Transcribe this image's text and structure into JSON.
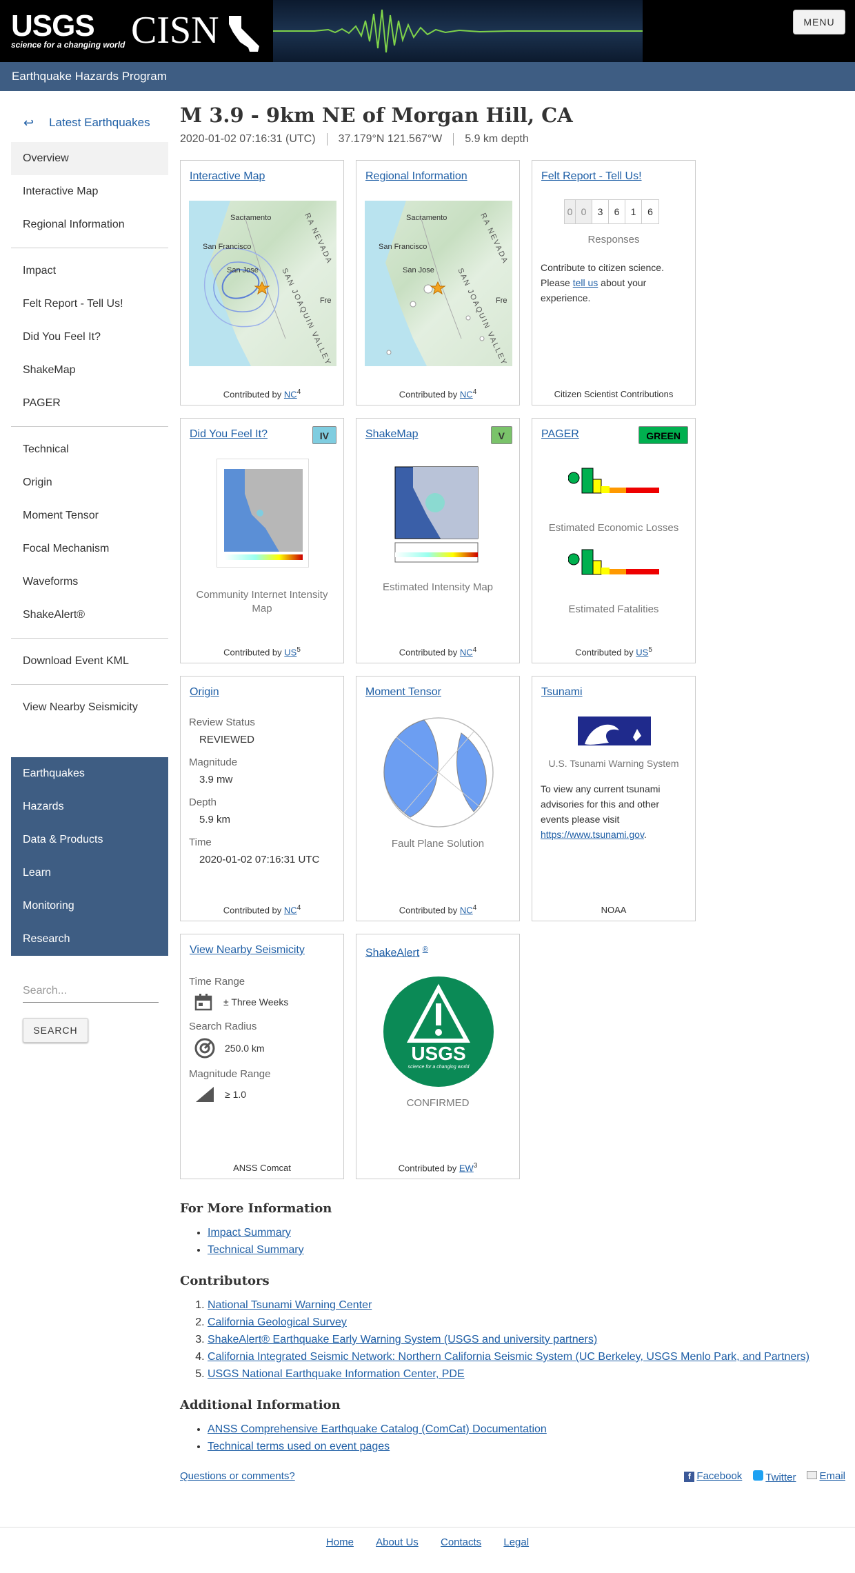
{
  "banner": {
    "usgs_word": "USGS",
    "usgs_tag": "science for a changing world",
    "cisn": "CISN",
    "menu": "MENU"
  },
  "program_title": "Earthquake Hazards Program",
  "sidebar": {
    "back": "Latest Earthquakes",
    "group1": [
      "Overview",
      "Interactive Map",
      "Regional Information"
    ],
    "group2": [
      "Impact",
      "Felt Report - Tell Us!",
      "Did You Feel It?",
      "ShakeMap",
      "PAGER"
    ],
    "group3": [
      "Technical",
      "Origin",
      "Moment Tensor",
      "Focal Mechanism",
      "Waveforms",
      "ShakeAlert®"
    ],
    "group4": [
      "Download Event KML"
    ],
    "group5": [
      "View Nearby Seismicity"
    ],
    "dark": [
      "Earthquakes",
      "Hazards",
      "Data & Products",
      "Learn",
      "Monitoring",
      "Research"
    ],
    "search_placeholder": "Search...",
    "search_button": "SEARCH"
  },
  "event": {
    "title": "M 3.9 - 9km NE of Morgan Hill, CA",
    "time": "2020-01-02 07:16:31 (UTC)",
    "location": "37.179°N 121.567°W",
    "depth": "5.9 km depth"
  },
  "cards": {
    "interactive_map": {
      "title": "Interactive Map",
      "contrib": "Contributed by ",
      "net": "NC",
      "n": "4",
      "map_labels": [
        "Sacramento",
        "San Francisco",
        "San Jose",
        "SAN JOAQUIN VALLEY",
        "RA NEVADA",
        "Fre"
      ]
    },
    "regional": {
      "title": "Regional Information",
      "contrib": "Contributed by ",
      "net": "NC",
      "n": "4",
      "map_labels": [
        "Sacramento",
        "San Francisco",
        "San Jose",
        "SAN JOAQUIN VALLEY",
        "RA NEVADA",
        "Fre"
      ]
    },
    "felt": {
      "title": "Felt Report - Tell Us!",
      "digits": [
        "0",
        "0",
        "3",
        "6",
        "1",
        "6"
      ],
      "responses": "Responses",
      "text1": "Contribute to citizen science. Please ",
      "tell_us": "tell us",
      "text2": " about your experience.",
      "foot": "Citizen Scientist Contributions"
    },
    "dyfi": {
      "title": "Did You Feel It?",
      "badge": "IV",
      "badge_color": "#7fcde0",
      "sub": "Community Internet Intensity Map",
      "contrib": "Contributed by ",
      "net": "US",
      "n": "5"
    },
    "shakemap": {
      "title": "ShakeMap",
      "badge": "V",
      "badge_color": "#7ac36a",
      "sub": "Estimated Intensity Map",
      "contrib": "Contributed by ",
      "net": "NC",
      "n": "4"
    },
    "pager": {
      "title": "PAGER",
      "badge": "GREEN",
      "badge_color": "#00b04f",
      "sub1": "Estimated Economic Losses",
      "sub2": "Estimated Fatalities",
      "contrib": "Contributed by ",
      "net": "US",
      "n": "5"
    },
    "origin": {
      "title": "Origin",
      "rows": [
        {
          "k": "Review Status",
          "v": "REVIEWED"
        },
        {
          "k": "Magnitude",
          "v": "3.9 mw"
        },
        {
          "k": "Depth",
          "v": "5.9 km"
        },
        {
          "k": "Time",
          "v": "2020-01-02 07:16:31 UTC"
        }
      ],
      "contrib": "Contributed by ",
      "net": "NC",
      "n": "4"
    },
    "moment": {
      "title": "Moment Tensor",
      "sub": "Fault Plane Solution",
      "contrib": "Contributed by ",
      "net": "NC",
      "n": "4"
    },
    "tsunami": {
      "title": "Tsunami",
      "sub": "U.S. Tsunami Warning System",
      "text": "To view any current tsunami advisories for this and other events please visit ",
      "link": "https://www.tsunami.gov",
      "dot": ".",
      "foot": "NOAA"
    },
    "nearby": {
      "title": "View Nearby Seismicity",
      "rows": [
        {
          "k": "Time Range",
          "v": "± Three Weeks"
        },
        {
          "k": "Search Radius",
          "v": "250.0 km"
        },
        {
          "k": "Magnitude Range",
          "v": "≥ 1.0"
        }
      ],
      "foot": "ANSS Comcat"
    },
    "shakealert": {
      "title": "ShakeAlert",
      "reg": "®",
      "logo_usgs": "USGS",
      "logo_tag": "science for a changing world",
      "sub": "CONFIRMED",
      "contrib": "Contributed by ",
      "net": "EW",
      "n": "3"
    }
  },
  "more_info": {
    "heading": "For More Information",
    "items": [
      "Impact Summary",
      "Technical Summary"
    ]
  },
  "contributors": {
    "heading": "Contributors",
    "items": [
      "National Tsunami Warning Center",
      "California Geological Survey",
      "ShakeAlert® Earthquake Early Warning System (USGS and university partners)",
      "California Integrated Seismic Network: Northern California Seismic System (UC Berkeley, USGS Menlo Park, and Partners)",
      "USGS National Earthquake Information Center, PDE"
    ]
  },
  "additional": {
    "heading": "Additional Information",
    "items": [
      "ANSS Comprehensive Earthquake Catalog (ComCat) Documentation",
      "Technical terms used on event pages"
    ]
  },
  "questions": "Questions or comments?",
  "social": [
    "Facebook",
    "Twitter",
    "Email"
  ],
  "footer": [
    "Home",
    "About Us",
    "Contacts",
    "Legal"
  ]
}
